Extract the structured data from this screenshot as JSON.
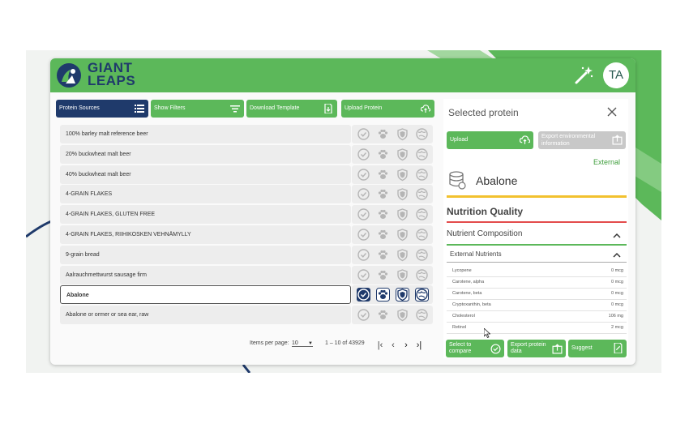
{
  "app": {
    "logo_line1": "GIANT",
    "logo_line2": "LEAPS",
    "avatar_initials": "TA",
    "brand_green": "#5cb85a",
    "brand_navy": "#1f3a6b"
  },
  "toolbar": {
    "protein_sources": "Protein Sources",
    "show_filters": "Show Filters",
    "download_template": "Download Template",
    "upload_protein": "Upload Protein"
  },
  "proteins": [
    {
      "name": "100% barley malt reference beer",
      "selected": false
    },
    {
      "name": "20% buckwheat malt beer",
      "selected": false
    },
    {
      "name": "40% buckwheat malt beer",
      "selected": false
    },
    {
      "name": "4-GRAIN FLAKES",
      "selected": false
    },
    {
      "name": "4-GRAIN FLAKES, GLUTEN FREE",
      "selected": false
    },
    {
      "name": "4-GRAIN FLAKES, RIIHIKOSKEN VEHNÄMYLLY",
      "selected": false
    },
    {
      "name": "9-grain bread",
      "selected": false
    },
    {
      "name": "Aalrauchmettwurst sausage firm",
      "selected": false
    },
    {
      "name": "Abalone",
      "selected": true
    },
    {
      "name": "Abalone or ormer or sea ear, raw",
      "selected": false
    }
  ],
  "row_action_icons": [
    "check-circle-icon",
    "paw-icon",
    "shield-icon",
    "globe-icon"
  ],
  "pagination": {
    "items_per_page_label": "Items per page:",
    "items_per_page": "10",
    "range": "1 – 10 of 43929"
  },
  "panel": {
    "title": "Selected protein",
    "upload": "Upload",
    "export_env": "Export environmental information",
    "source_tag": "External",
    "protein_name": "Abalone",
    "nutrition_quality": "Nutrition Quality",
    "nutrient_composition": "Nutrient Composition",
    "external_nutrients": "External Nutrients",
    "nutrients": [
      {
        "name": "Lycopene",
        "value": "0 mcg"
      },
      {
        "name": "Carotene, alpha",
        "value": "0 mcg"
      },
      {
        "name": "Carotene, beta",
        "value": "0 mcg"
      },
      {
        "name": "Cryptoxanthin, beta",
        "value": "0 mcg"
      },
      {
        "name": "Cholesterol",
        "value": "106 mg"
      },
      {
        "name": "Retinol",
        "value": "2 mcg"
      }
    ],
    "select_compare": "Select to compare",
    "export_data": "Export protein data",
    "suggest": "Suggest"
  }
}
